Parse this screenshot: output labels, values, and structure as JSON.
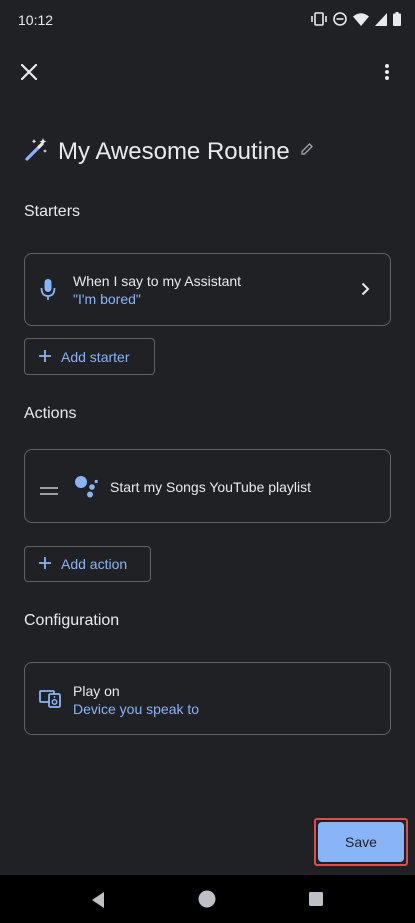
{
  "status_bar": {
    "time": "10:12",
    "icons": [
      "vibrate-icon",
      "dnd-icon",
      "wifi-icon",
      "signal-icon",
      "battery-icon"
    ]
  },
  "top_bar": {
    "close_icon": "close-icon",
    "more_icon": "more-vert-icon"
  },
  "routine": {
    "icon": "magic-wand-icon",
    "title": "My Awesome Routine",
    "edit_icon": "pencil-icon"
  },
  "starters": {
    "heading": "Starters",
    "item": {
      "icon": "mic-icon",
      "title": "When I say to my Assistant",
      "subtitle": "\"I'm bored\"",
      "chevron": "chevron-right-icon"
    },
    "add_label": "Add starter"
  },
  "actions": {
    "heading": "Actions",
    "item": {
      "drag_icon": "drag-handle-icon",
      "icon": "google-assistant-icon",
      "title": "Start my Songs YouTube playlist"
    },
    "add_label": "Add action"
  },
  "configuration": {
    "heading": "Configuration",
    "item": {
      "icon": "speaker-device-icon",
      "title": "Play on",
      "subtitle": "Device you speak to"
    }
  },
  "save_label": "Save",
  "colors": {
    "background": "#202124",
    "accent": "#8ab4f8",
    "border": "#5f6368",
    "highlight": "#e04b4b"
  },
  "nav_bar": [
    "back-icon",
    "home-icon",
    "recents-icon"
  ]
}
